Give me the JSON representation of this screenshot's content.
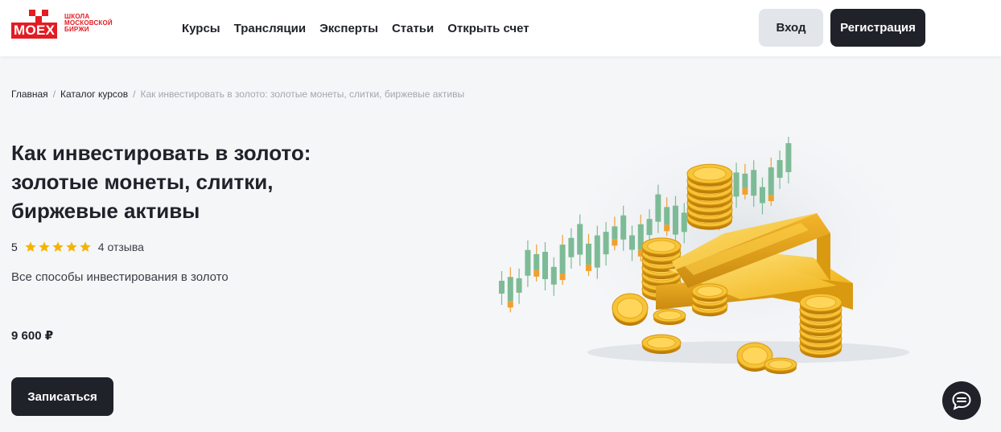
{
  "header": {
    "logo": {
      "word": "MOEX",
      "school_lines": [
        "ШКОЛА",
        "МОСКОВСКОЙ",
        "БИРЖИ"
      ]
    },
    "nav": [
      {
        "label": "Курсы"
      },
      {
        "label": "Трансляции"
      },
      {
        "label": "Эксперты"
      },
      {
        "label": "Статьи"
      },
      {
        "label": "Открыть счет"
      }
    ],
    "login_label": "Вход",
    "register_label": "Регистрация"
  },
  "breadcrumb": {
    "items": [
      "Главная",
      "Каталог курсов"
    ],
    "separator": "/",
    "current": "Как инвестировать в золото: золотые монеты, слитки, биржевые активы"
  },
  "course": {
    "title": "Как инвестировать в золото: золотые монеты, слитки, биржевые активы",
    "rating": "5",
    "stars": 5,
    "reviews": "4 отзыва",
    "subtitle": "Все способы инвестирования в золото",
    "price": "9 600 ₽",
    "enroll_label": "Записаться"
  },
  "colors": {
    "brand_red": "#e31b23",
    "dark": "#1f2229",
    "star": "#f5b400",
    "candle_green": "#7dbb96",
    "candle_orange": "#f0a030",
    "gold": "#f2b820"
  },
  "icons": {
    "star": "star-icon",
    "chat": "chat-icon"
  }
}
